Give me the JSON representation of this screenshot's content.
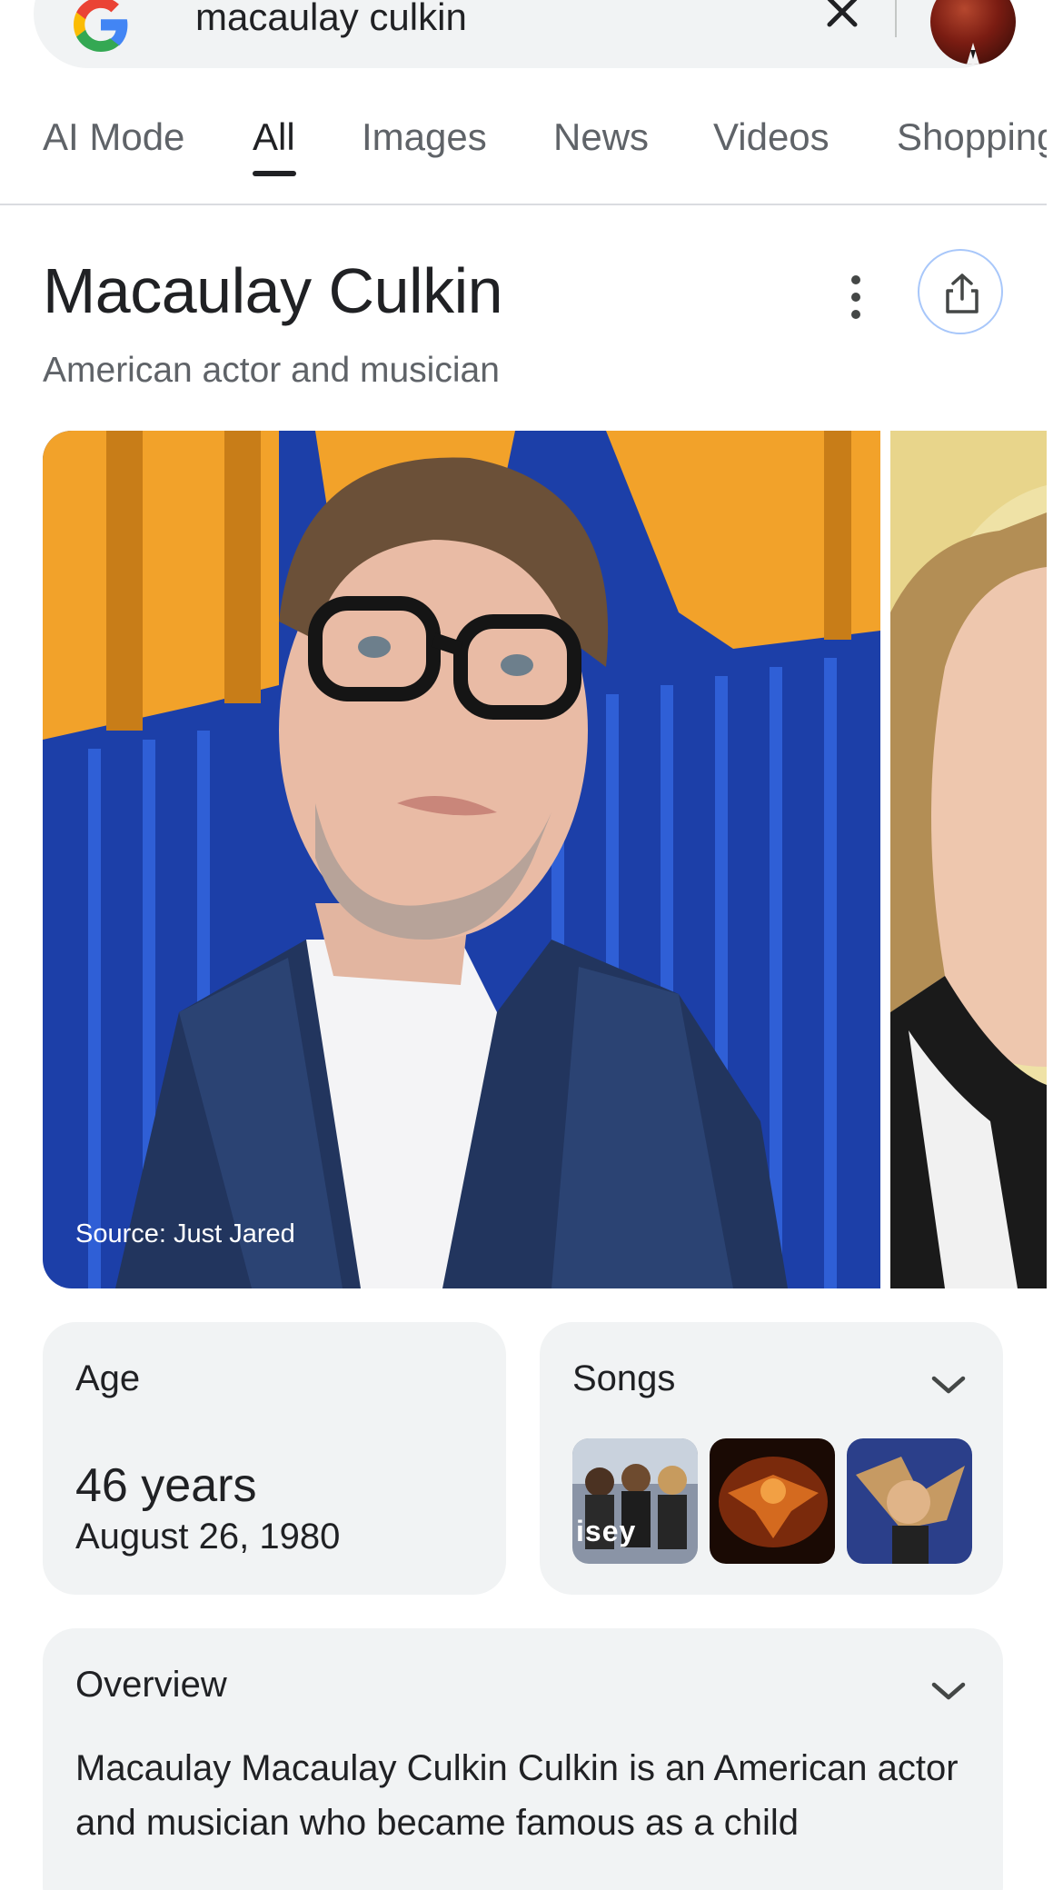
{
  "search": {
    "query": "macaulay culkin",
    "logo_icon": "google-g-icon",
    "clear_icon": "close-icon"
  },
  "tabs": [
    {
      "label": "AI Mode",
      "active": false
    },
    {
      "label": "All",
      "active": true
    },
    {
      "label": "Images",
      "active": false
    },
    {
      "label": "News",
      "active": false
    },
    {
      "label": "Videos",
      "active": false
    },
    {
      "label": "Shopping",
      "active": false
    }
  ],
  "entity": {
    "title": "Macaulay Culkin",
    "subtitle": "American actor and musician",
    "more_icon": "more-vert-icon",
    "share_icon": "share-icon"
  },
  "images": {
    "main_source": "Source: Just Jared"
  },
  "age_card": {
    "label": "Age",
    "value": "46 years",
    "date": "August 26, 1980"
  },
  "songs_card": {
    "label": "Songs",
    "expand_icon": "chevron-down-icon",
    "thumbs": [
      {
        "caption": "isey"
      },
      {
        "caption": ""
      },
      {
        "caption": ""
      }
    ]
  },
  "overview_card": {
    "label": "Overview",
    "expand_icon": "chevron-down-icon",
    "text": "Macaulay Macaulay Culkin Culkin is an American actor and musician who became famous as a child"
  },
  "colors": {
    "card_bg": "#f1f3f4",
    "text_primary": "#202124",
    "text_secondary": "#5f6368",
    "share_border": "#a8c7fa"
  }
}
